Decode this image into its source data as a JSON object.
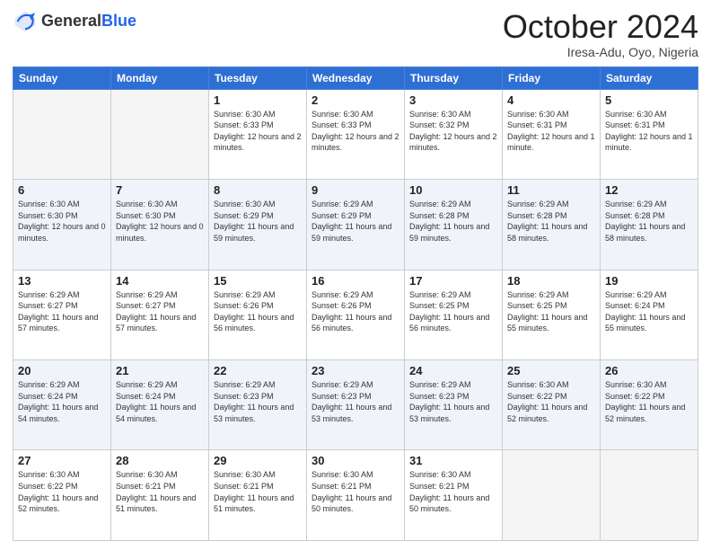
{
  "logo": {
    "general": "General",
    "blue": "Blue"
  },
  "header": {
    "month": "October 2024",
    "location": "Iresa-Adu, Oyo, Nigeria"
  },
  "days_of_week": [
    "Sunday",
    "Monday",
    "Tuesday",
    "Wednesday",
    "Thursday",
    "Friday",
    "Saturday"
  ],
  "weeks": [
    [
      {
        "day": "",
        "empty": true
      },
      {
        "day": "",
        "empty": true
      },
      {
        "day": "1",
        "sunrise": "Sunrise: 6:30 AM",
        "sunset": "Sunset: 6:33 PM",
        "daylight": "Daylight: 12 hours and 2 minutes."
      },
      {
        "day": "2",
        "sunrise": "Sunrise: 6:30 AM",
        "sunset": "Sunset: 6:33 PM",
        "daylight": "Daylight: 12 hours and 2 minutes."
      },
      {
        "day": "3",
        "sunrise": "Sunrise: 6:30 AM",
        "sunset": "Sunset: 6:32 PM",
        "daylight": "Daylight: 12 hours and 2 minutes."
      },
      {
        "day": "4",
        "sunrise": "Sunrise: 6:30 AM",
        "sunset": "Sunset: 6:31 PM",
        "daylight": "Daylight: 12 hours and 1 minute."
      },
      {
        "day": "5",
        "sunrise": "Sunrise: 6:30 AM",
        "sunset": "Sunset: 6:31 PM",
        "daylight": "Daylight: 12 hours and 1 minute."
      }
    ],
    [
      {
        "day": "6",
        "sunrise": "Sunrise: 6:30 AM",
        "sunset": "Sunset: 6:30 PM",
        "daylight": "Daylight: 12 hours and 0 minutes."
      },
      {
        "day": "7",
        "sunrise": "Sunrise: 6:30 AM",
        "sunset": "Sunset: 6:30 PM",
        "daylight": "Daylight: 12 hours and 0 minutes."
      },
      {
        "day": "8",
        "sunrise": "Sunrise: 6:30 AM",
        "sunset": "Sunset: 6:29 PM",
        "daylight": "Daylight: 11 hours and 59 minutes."
      },
      {
        "day": "9",
        "sunrise": "Sunrise: 6:29 AM",
        "sunset": "Sunset: 6:29 PM",
        "daylight": "Daylight: 11 hours and 59 minutes."
      },
      {
        "day": "10",
        "sunrise": "Sunrise: 6:29 AM",
        "sunset": "Sunset: 6:28 PM",
        "daylight": "Daylight: 11 hours and 59 minutes."
      },
      {
        "day": "11",
        "sunrise": "Sunrise: 6:29 AM",
        "sunset": "Sunset: 6:28 PM",
        "daylight": "Daylight: 11 hours and 58 minutes."
      },
      {
        "day": "12",
        "sunrise": "Sunrise: 6:29 AM",
        "sunset": "Sunset: 6:28 PM",
        "daylight": "Daylight: 11 hours and 58 minutes."
      }
    ],
    [
      {
        "day": "13",
        "sunrise": "Sunrise: 6:29 AM",
        "sunset": "Sunset: 6:27 PM",
        "daylight": "Daylight: 11 hours and 57 minutes."
      },
      {
        "day": "14",
        "sunrise": "Sunrise: 6:29 AM",
        "sunset": "Sunset: 6:27 PM",
        "daylight": "Daylight: 11 hours and 57 minutes."
      },
      {
        "day": "15",
        "sunrise": "Sunrise: 6:29 AM",
        "sunset": "Sunset: 6:26 PM",
        "daylight": "Daylight: 11 hours and 56 minutes."
      },
      {
        "day": "16",
        "sunrise": "Sunrise: 6:29 AM",
        "sunset": "Sunset: 6:26 PM",
        "daylight": "Daylight: 11 hours and 56 minutes."
      },
      {
        "day": "17",
        "sunrise": "Sunrise: 6:29 AM",
        "sunset": "Sunset: 6:25 PM",
        "daylight": "Daylight: 11 hours and 56 minutes."
      },
      {
        "day": "18",
        "sunrise": "Sunrise: 6:29 AM",
        "sunset": "Sunset: 6:25 PM",
        "daylight": "Daylight: 11 hours and 55 minutes."
      },
      {
        "day": "19",
        "sunrise": "Sunrise: 6:29 AM",
        "sunset": "Sunset: 6:24 PM",
        "daylight": "Daylight: 11 hours and 55 minutes."
      }
    ],
    [
      {
        "day": "20",
        "sunrise": "Sunrise: 6:29 AM",
        "sunset": "Sunset: 6:24 PM",
        "daylight": "Daylight: 11 hours and 54 minutes."
      },
      {
        "day": "21",
        "sunrise": "Sunrise: 6:29 AM",
        "sunset": "Sunset: 6:24 PM",
        "daylight": "Daylight: 11 hours and 54 minutes."
      },
      {
        "day": "22",
        "sunrise": "Sunrise: 6:29 AM",
        "sunset": "Sunset: 6:23 PM",
        "daylight": "Daylight: 11 hours and 53 minutes."
      },
      {
        "day": "23",
        "sunrise": "Sunrise: 6:29 AM",
        "sunset": "Sunset: 6:23 PM",
        "daylight": "Daylight: 11 hours and 53 minutes."
      },
      {
        "day": "24",
        "sunrise": "Sunrise: 6:29 AM",
        "sunset": "Sunset: 6:23 PM",
        "daylight": "Daylight: 11 hours and 53 minutes."
      },
      {
        "day": "25",
        "sunrise": "Sunrise: 6:30 AM",
        "sunset": "Sunset: 6:22 PM",
        "daylight": "Daylight: 11 hours and 52 minutes."
      },
      {
        "day": "26",
        "sunrise": "Sunrise: 6:30 AM",
        "sunset": "Sunset: 6:22 PM",
        "daylight": "Daylight: 11 hours and 52 minutes."
      }
    ],
    [
      {
        "day": "27",
        "sunrise": "Sunrise: 6:30 AM",
        "sunset": "Sunset: 6:22 PM",
        "daylight": "Daylight: 11 hours and 52 minutes."
      },
      {
        "day": "28",
        "sunrise": "Sunrise: 6:30 AM",
        "sunset": "Sunset: 6:21 PM",
        "daylight": "Daylight: 11 hours and 51 minutes."
      },
      {
        "day": "29",
        "sunrise": "Sunrise: 6:30 AM",
        "sunset": "Sunset: 6:21 PM",
        "daylight": "Daylight: 11 hours and 51 minutes."
      },
      {
        "day": "30",
        "sunrise": "Sunrise: 6:30 AM",
        "sunset": "Sunset: 6:21 PM",
        "daylight": "Daylight: 11 hours and 50 minutes."
      },
      {
        "day": "31",
        "sunrise": "Sunrise: 6:30 AM",
        "sunset": "Sunset: 6:21 PM",
        "daylight": "Daylight: 11 hours and 50 minutes."
      },
      {
        "day": "",
        "empty": true
      },
      {
        "day": "",
        "empty": true
      }
    ]
  ]
}
